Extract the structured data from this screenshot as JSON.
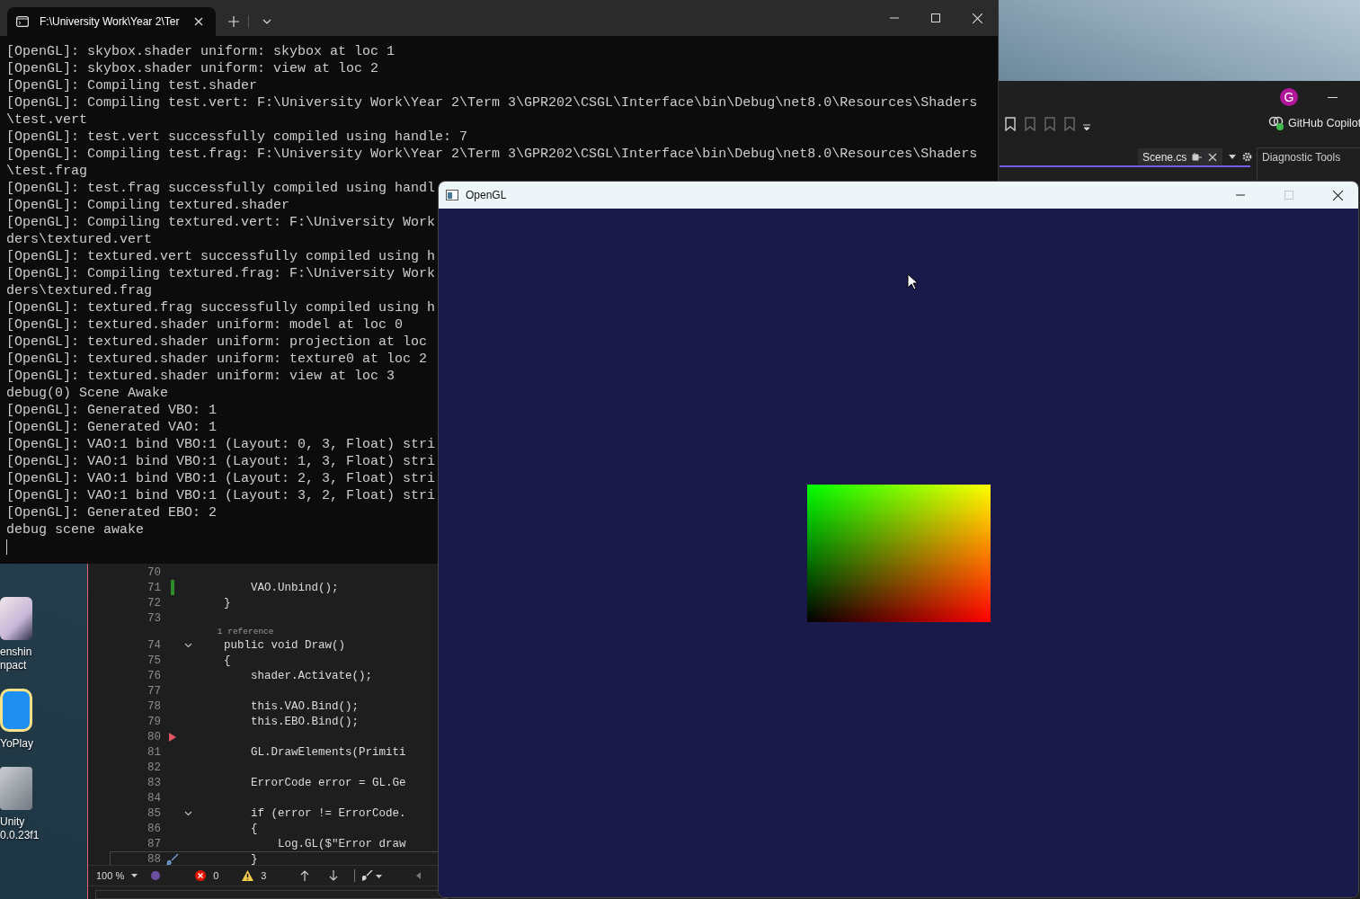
{
  "terminal": {
    "tab": {
      "title": "F:\\University Work\\Year 2\\Ter",
      "selected": true
    },
    "lines": [
      "[OpenGL]: skybox.shader uniform: skybox at loc 1",
      "[OpenGL]: skybox.shader uniform: view at loc 2",
      "[OpenGL]: Compiling test.shader",
      "[OpenGL]: Compiling test.vert: F:\\University Work\\Year 2\\Term 3\\GPR202\\CSGL\\Interface\\bin\\Debug\\net8.0\\Resources\\Shaders",
      "\\test.vert",
      "[OpenGL]: test.vert successfully compiled using handle: 7",
      "[OpenGL]: Compiling test.frag: F:\\University Work\\Year 2\\Term 3\\GPR202\\CSGL\\Interface\\bin\\Debug\\net8.0\\Resources\\Shaders",
      "\\test.frag",
      "[OpenGL]: test.frag successfully compiled using handl",
      "[OpenGL]: Compiling textured.shader",
      "[OpenGL]: Compiling textured.vert: F:\\University Work",
      "ders\\textured.vert",
      "[OpenGL]: textured.vert successfully compiled using h",
      "[OpenGL]: Compiling textured.frag: F:\\University Work",
      "ders\\textured.frag",
      "[OpenGL]: textured.frag successfully compiled using h",
      "[OpenGL]: textured.shader uniform: model at loc 0",
      "[OpenGL]: textured.shader uniform: projection at loc",
      "[OpenGL]: textured.shader uniform: texture0 at loc 2",
      "[OpenGL]: textured.shader uniform: view at loc 3",
      "debug(0) Scene Awake",
      "[OpenGL]: Generated VBO: 1",
      "[OpenGL]: Generated VAO: 1",
      "[OpenGL]: VAO:1 bind VBO:1 (Layout: 0, 3, Float) stri",
      "[OpenGL]: VAO:1 bind VBO:1 (Layout: 1, 3, Float) stri",
      "[OpenGL]: VAO:1 bind VBO:1 (Layout: 2, 3, Float) stri",
      "[OpenGL]: VAO:1 bind VBO:1 (Layout: 3, 2, Float) stri",
      "[OpenGL]: Generated EBO: 2",
      "debug scene awake"
    ]
  },
  "visual_studio": {
    "avatar_initial": "G",
    "copilot_label": "GitHub Copilot",
    "document_tabs": [
      {
        "label": "Scene.cs",
        "selected": true
      }
    ],
    "diagnostic_tools": {
      "title": "Diagnostic Tools"
    },
    "editor": {
      "lines": [
        {
          "kind": "code",
          "number": "70",
          "fold": false,
          "changed": false,
          "arrow": false,
          "current": false
        },
        {
          "kind": "code",
          "number": "71",
          "text": "        VAO.Unbind();",
          "fold": false,
          "changed": true,
          "arrow": false,
          "current": false
        },
        {
          "kind": "code",
          "number": "72",
          "text": "    }",
          "fold": false,
          "changed": false,
          "arrow": false,
          "current": false
        },
        {
          "kind": "code",
          "number": "73",
          "fold": false,
          "changed": false,
          "arrow": false,
          "current": false
        },
        {
          "kind": "codelens",
          "text": "    1 reference"
        },
        {
          "kind": "code",
          "number": "74",
          "text": "    public void Draw()",
          "fold": true,
          "changed": false,
          "arrow": false,
          "current": false
        },
        {
          "kind": "code",
          "number": "75",
          "text": "    {",
          "fold": false,
          "changed": false,
          "arrow": false,
          "current": false
        },
        {
          "kind": "code",
          "number": "76",
          "text": "        shader.Activate();",
          "fold": false,
          "changed": false,
          "arrow": false,
          "current": false
        },
        {
          "kind": "code",
          "number": "77",
          "fold": false,
          "changed": false,
          "arrow": false,
          "current": false
        },
        {
          "kind": "code",
          "number": "78",
          "text": "        this.VAO.Bind();",
          "fold": false,
          "changed": false,
          "arrow": false,
          "current": false
        },
        {
          "kind": "code",
          "number": "79",
          "text": "        this.EBO.Bind();",
          "fold": false,
          "changed": false,
          "arrow": false,
          "current": false
        },
        {
          "kind": "code",
          "number": "80",
          "fold": false,
          "changed": false,
          "arrow": true,
          "current": false
        },
        {
          "kind": "code",
          "number": "81",
          "text": "        GL.DrawElements(Primiti",
          "fold": false,
          "changed": false,
          "arrow": false,
          "current": false
        },
        {
          "kind": "code",
          "number": "82",
          "fold": false,
          "changed": false,
          "arrow": false,
          "current": false
        },
        {
          "kind": "code",
          "number": "83",
          "text": "        ErrorCode error = GL.Ge",
          "fold": false,
          "changed": false,
          "arrow": false,
          "current": false
        },
        {
          "kind": "code",
          "number": "84",
          "fold": false,
          "changed": false,
          "arrow": false,
          "current": false
        },
        {
          "kind": "code",
          "number": "85",
          "text": "        if (error != ErrorCode.",
          "fold": true,
          "changed": false,
          "arrow": false,
          "current": false
        },
        {
          "kind": "code",
          "number": "86",
          "text": "        {",
          "fold": false,
          "changed": false,
          "arrow": false,
          "current": false
        },
        {
          "kind": "code",
          "number": "87",
          "text": "            Log.GL($\"Error draw",
          "fold": false,
          "changed": false,
          "arrow": false,
          "current": false
        },
        {
          "kind": "code",
          "number": "88",
          "text": "        }",
          "fold": false,
          "changed": false,
          "arrow": false,
          "current": true
        }
      ]
    },
    "status_bar": {
      "zoom": "100 %",
      "errors": "0",
      "warnings": "3"
    }
  },
  "opengl_window": {
    "title": "OpenGL",
    "maximize_disabled": true
  },
  "desktop_icons": [
    {
      "kind": "picture",
      "label_lines": [
        "enshin",
        "npact"
      ]
    },
    {
      "kind": "chat",
      "label_lines": [
        "YoPlay"
      ]
    },
    {
      "kind": "cube",
      "label_lines": [
        "Unity",
        "0.0.23f1"
      ]
    }
  ]
}
